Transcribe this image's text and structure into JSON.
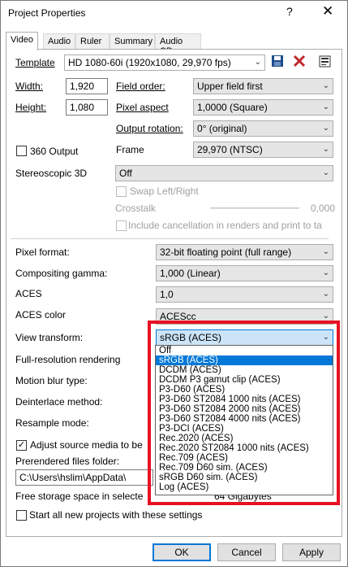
{
  "window": {
    "title": "Project Properties",
    "help": "?",
    "close": "✕"
  },
  "tabs": [
    "Video",
    "Audio",
    "Ruler",
    "Summary",
    "Audio CD"
  ],
  "template": {
    "label": "Template",
    "value": "HD 1080-60i (1920x1080, 29,970 fps)"
  },
  "width": {
    "label": "Width:",
    "value": "1,920"
  },
  "height": {
    "label": "Height:",
    "value": "1,080"
  },
  "field_order": {
    "label": "Field order:",
    "value": "Upper field first"
  },
  "pixel_aspect": {
    "label": "Pixel aspect",
    "value": "1,0000 (Square)"
  },
  "output_rotation": {
    "label": "Output rotation:",
    "value": "0° (original)"
  },
  "output_360": {
    "label": "360 Output",
    "checked": false
  },
  "frame": {
    "label": "Frame",
    "value": "29,970 (NTSC)"
  },
  "stereoscopic": {
    "label": "Stereoscopic 3D",
    "value": "Off"
  },
  "swap": {
    "label": "Swap Left/Right"
  },
  "crosstalk": {
    "label": "Crosstalk",
    "value": "0,000"
  },
  "include_cancellation": {
    "label": "Include cancellation in renders and print to ta"
  },
  "pixel_format": {
    "label": "Pixel format:",
    "value": "32-bit floating point (full range)"
  },
  "compositing_gamma": {
    "label": "Compositing gamma:",
    "value": "1,000 (Linear)"
  },
  "aces": {
    "label": "ACES",
    "value": "1,0"
  },
  "aces_color": {
    "label": "ACES color",
    "value": "ACEScc"
  },
  "view_transform": {
    "label": "View transform:",
    "value": "sRGB (ACES)",
    "options": [
      "Off",
      "sRGB (ACES)",
      "DCDM (ACES)",
      "DCDM P3 gamut clip (ACES)",
      "P3-D60 (ACES)",
      "P3-D60 ST2084 1000 nits (ACES)",
      "P3-D60 ST2084 2000 nits (ACES)",
      "P3-D60 ST2084 4000 nits (ACES)",
      "P3-DCI (ACES)",
      "Rec.2020 (ACES)",
      "Rec.2020 ST2084 1000 nits (ACES)",
      "Rec.709 (ACES)",
      "Rec.709 D60 sim. (ACES)",
      "sRGB D60 sim. (ACES)",
      "Log (ACES)"
    ],
    "selected_index": 1
  },
  "full_res": {
    "label": "Full-resolution rendering"
  },
  "motion_blur": {
    "label": "Motion blur type:"
  },
  "deinterlace": {
    "label": "Deinterlace method:"
  },
  "resample": {
    "label": "Resample mode:"
  },
  "adjust_source": {
    "label": "Adjust source media to be",
    "checked": true
  },
  "prerendered": {
    "label": "Prerendered files folder:",
    "value": "C:\\Users\\hslim\\AppData\\"
  },
  "free_storage": {
    "label": "Free storage space in selecte",
    "value": "64 Gigabytes"
  },
  "start_all": {
    "label": "Start all new projects with these settings",
    "checked": false
  },
  "buttons": {
    "ok": "OK",
    "cancel": "Cancel",
    "apply": "Apply"
  },
  "colors": {
    "highlight": "#0078d7",
    "annotation": "#e81123"
  }
}
